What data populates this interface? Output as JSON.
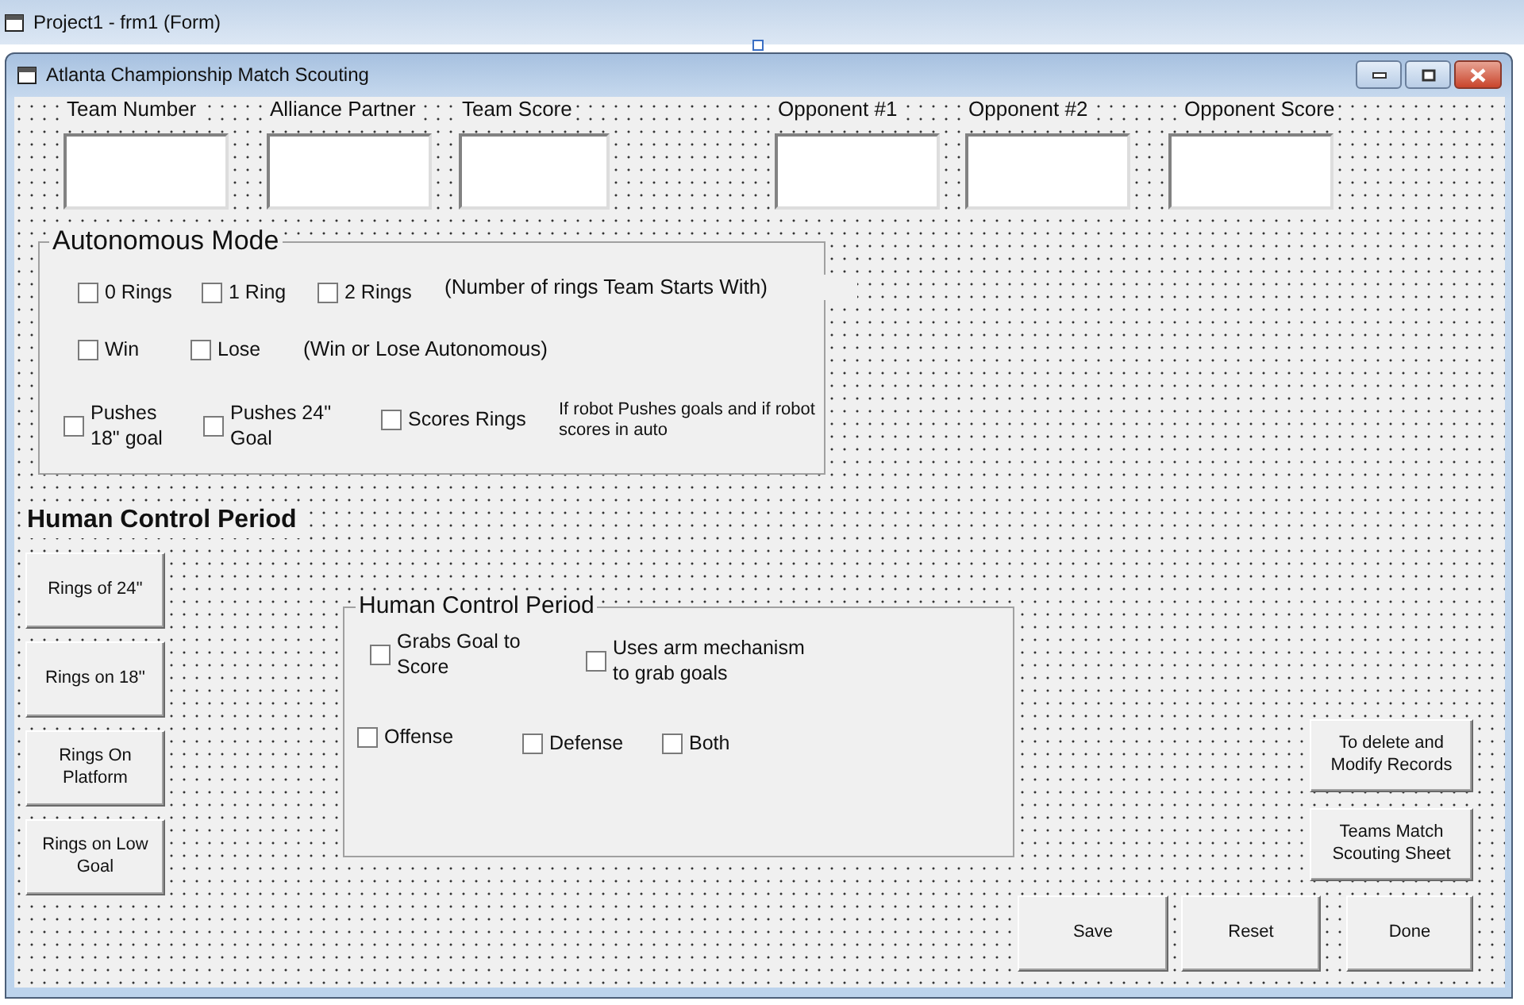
{
  "designer": {
    "title": "Project1 - frm1 (Form)"
  },
  "form": {
    "title": "Atlanta Championship Match Scouting"
  },
  "fields": [
    {
      "label": "Team Number"
    },
    {
      "label": "Alliance Partner"
    },
    {
      "label": "Team Score"
    },
    {
      "label": "Opponent #1"
    },
    {
      "label": "Opponent #2"
    },
    {
      "label": "Opponent Score"
    }
  ],
  "autonomous": {
    "title": "Autonomous Mode",
    "checkboxes": [
      {
        "label": "0 Rings",
        "checked": false
      },
      {
        "label": "1 Ring",
        "checked": false
      },
      {
        "label": "2 Rings",
        "checked": false
      },
      {
        "label": "Win",
        "checked": false
      },
      {
        "label": "Lose",
        "checked": false
      },
      {
        "label": "Pushes 18\" goal",
        "checked": false
      },
      {
        "label": "Pushes 24\" Goal",
        "checked": false
      },
      {
        "label": "Scores Rings",
        "checked": false
      }
    ],
    "notes": [
      "(Number of rings Team Starts With)",
      "(Win or Lose Autonomous)",
      "If robot Pushes goals and if robot scores in auto"
    ]
  },
  "human_heading": "Human Control Period",
  "ring_buttons": [
    "Rings of 24''",
    "Rings on 18''",
    "Rings On Platform",
    "Rings on Low Goal"
  ],
  "human": {
    "title": "Human Control Period",
    "checkboxes": [
      {
        "label": "Grabs Goal to Score",
        "checked": false
      },
      {
        "label": "Uses arm mechanism to grab goals",
        "checked": false
      },
      {
        "label": "Offense",
        "checked": false
      },
      {
        "label": "Defense",
        "checked": false
      },
      {
        "label": "Both",
        "checked": false
      }
    ]
  },
  "buttons": [
    "To delete and Modify Records",
    "Teams Match Scouting Sheet",
    "Save",
    "Reset",
    "Done"
  ]
}
